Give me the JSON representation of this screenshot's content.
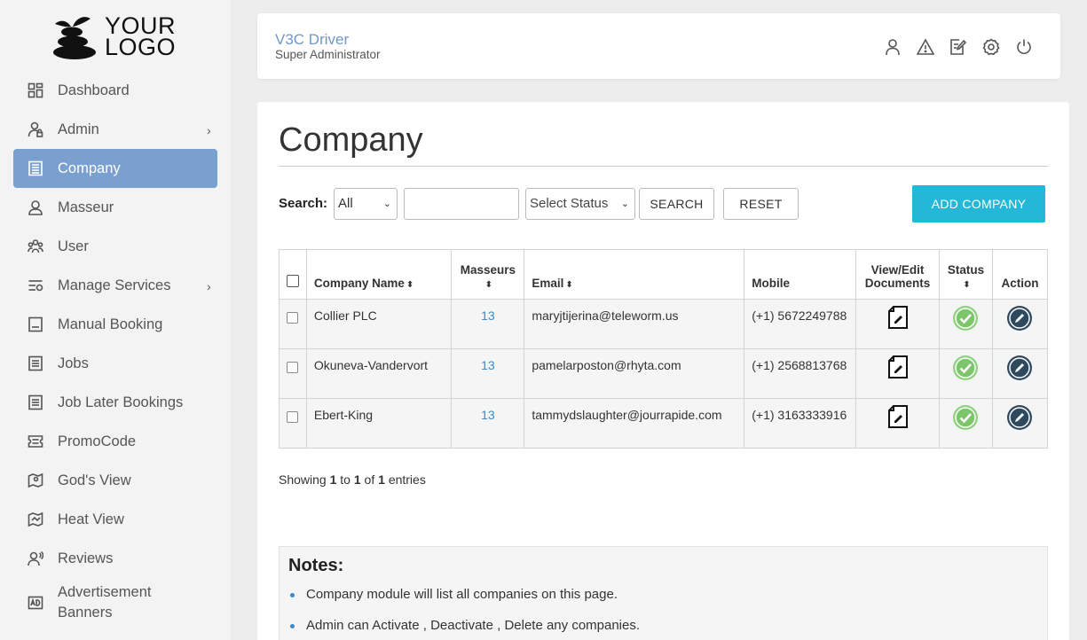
{
  "logo": {
    "line1": "YOUR",
    "line2": "LOGO"
  },
  "sidebar": {
    "items": [
      {
        "label": "Dashboard",
        "icon": "dashboard-icon"
      },
      {
        "label": "Admin",
        "icon": "admin-icon",
        "has_submenu": true
      },
      {
        "label": "Company",
        "icon": "company-icon",
        "active": true
      },
      {
        "label": "Masseur",
        "icon": "masseur-icon"
      },
      {
        "label": "User",
        "icon": "users-icon"
      },
      {
        "label": "Manage Services",
        "icon": "manage-services-icon",
        "has_submenu": true
      },
      {
        "label": "Manual Booking",
        "icon": "manual-booking-icon"
      },
      {
        "label": "Jobs",
        "icon": "jobs-icon"
      },
      {
        "label": "Job Later Bookings",
        "icon": "job-later-icon"
      },
      {
        "label": "PromoCode",
        "icon": "ticket-icon"
      },
      {
        "label": "God's View",
        "icon": "map-pin-icon"
      },
      {
        "label": "Heat View",
        "icon": "heat-map-icon"
      },
      {
        "label": "Reviews",
        "icon": "reviews-icon"
      },
      {
        "label_line1": "Advertisement",
        "label_line2": "Banners",
        "icon": "ad-icon"
      }
    ],
    "active_color": "#7aa0cf"
  },
  "header": {
    "title": "V3C Driver",
    "subtitle": "Super Administrator",
    "icons": [
      "user-icon",
      "alert-icon",
      "edit-note-icon",
      "settings-icon",
      "power-icon"
    ]
  },
  "main": {
    "title": "Company",
    "search": {
      "label": "Search:",
      "field_select": "All",
      "query_value": "",
      "status_select": "Select Status",
      "search_button": "SEARCH",
      "reset_button": "RESET"
    },
    "add_button": "ADD COMPANY",
    "accent_color": "#23b7d8",
    "table": {
      "columns": {
        "name": "Company Name",
        "masseurs": "Masseurs",
        "email": "Email",
        "mobile": "Mobile",
        "docs_line1": "View/Edit",
        "docs_line2": "Documents",
        "status": "Status",
        "action": "Action"
      },
      "rows": [
        {
          "name": "Collier PLC",
          "masseurs": "13",
          "email": "maryjtijerina@teleworm.us",
          "mobile": "(+1) 5672249788",
          "status": "active"
        },
        {
          "name": "Okuneva-Vandervort",
          "masseurs": "13",
          "email": "pamelarposton@rhyta.com",
          "mobile": "(+1) 2568813768",
          "status": "active"
        },
        {
          "name": "Ebert-King",
          "masseurs": "13",
          "email": "tammydslaughter@jourrapide.com",
          "mobile": "(+1) 3163333916",
          "status": "active"
        }
      ]
    },
    "pagination": {
      "prefix": "Showing",
      "from": "1",
      "to_word": "to",
      "to": "1",
      "of_word": "of",
      "total": "1",
      "suffix": "entries"
    },
    "notes": {
      "title": "Notes:",
      "items": [
        "Company module will list all companies on this page.",
        "Admin can Activate , Deactivate , Delete any companies."
      ]
    }
  }
}
